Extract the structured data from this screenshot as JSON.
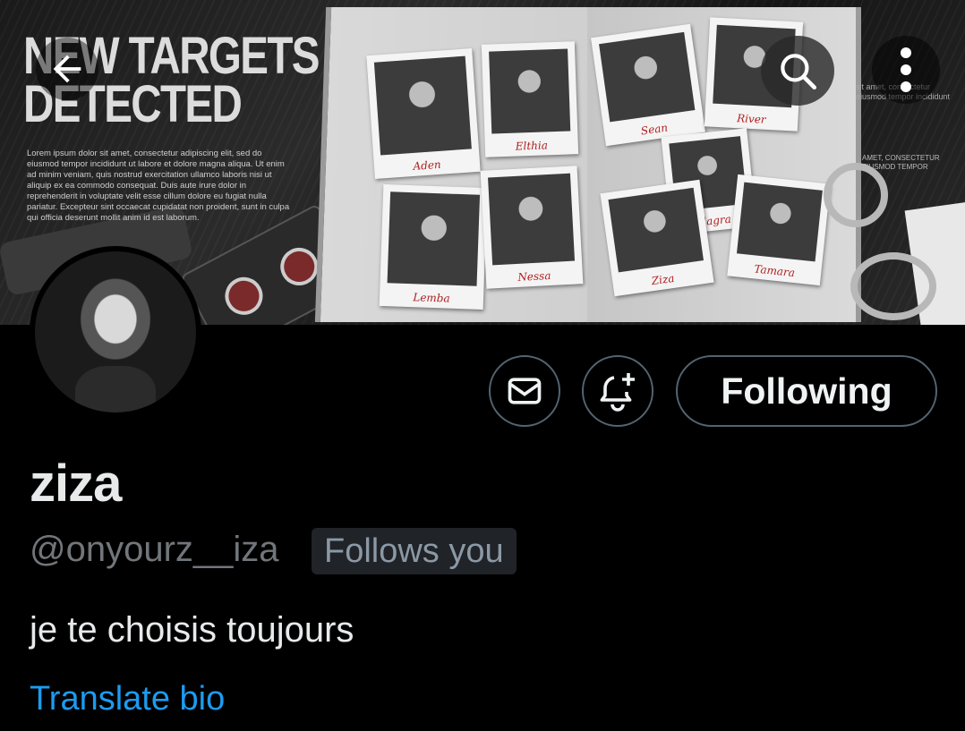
{
  "header": {
    "banner_headline": [
      "NEW TARGETS",
      "DETECTED"
    ],
    "banner_lorem": "Lorem ipsum dolor sit amet, consectetur adipiscing elit, sed do eiusmod tempor incididunt ut labore et dolore magna aliqua. Ut enim ad minim veniam, quis nostrud exercitation ullamco laboris nisi ut aliquip ex ea commodo consequat. Duis aute irure dolor in reprehenderit in voluptate velit esse cillum dolore eu fugiat nulla pariatur. Excepteur sint occaecat cupidatat non proident, sunt in culpa qui officia deserunt mollit anim id est laborum.",
    "banner_right_text_1": [
      "sit amet, consectetur",
      "eiusmod tempor incididunt"
    ],
    "banner_right_text_2": [
      "AMET, CONSECTETUR",
      "EIUSMOD TEMPOR"
    ],
    "polaroid_names": [
      "Aden",
      "Elthia",
      "Lemba",
      "Nessa",
      "Sean",
      "River",
      "Elagra",
      "Ziza",
      "Tamara"
    ],
    "icons": {
      "back": "arrow-left-icon",
      "search": "search-icon",
      "more": "more-vertical-icon"
    }
  },
  "actions": {
    "message_icon": "envelope-icon",
    "notify_icon": "bell-plus-icon",
    "follow_state_label": "Following"
  },
  "profile": {
    "display_name": "ziza",
    "handle": "@onyourz__iza",
    "follows_you_label": "Follows you",
    "bio": "je te choisis toujours",
    "translate_label": "Translate bio"
  },
  "colors": {
    "background": "#000000",
    "text_primary": "#e7e9ea",
    "text_secondary": "#71767b",
    "link": "#1d9bf0",
    "border": "#536471",
    "badge_bg": "#202327"
  }
}
